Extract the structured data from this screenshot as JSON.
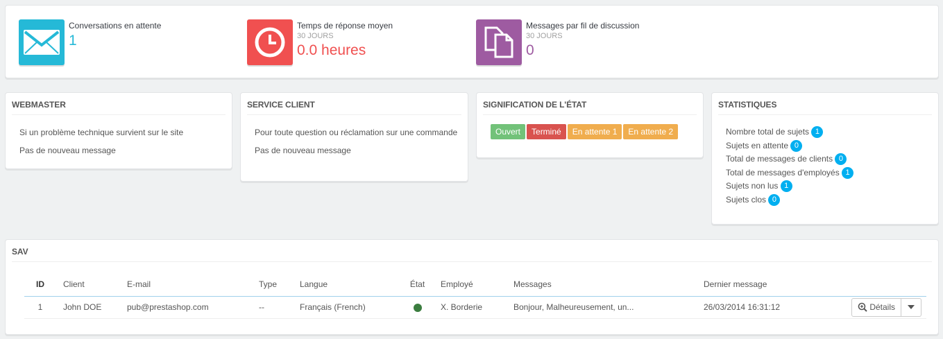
{
  "kpis": [
    {
      "title": "Conversations en attente",
      "sub": "",
      "value": "1",
      "color": "#25b9d7",
      "icon": "envelope-icon"
    },
    {
      "title": "Temps de réponse moyen",
      "sub": "30 JOURS",
      "value": "0.0 heures",
      "color": "#f05050",
      "icon": "clock-icon"
    },
    {
      "title": "Messages par fil de discussion",
      "sub": "30 JOURS",
      "value": "0",
      "color": "#9e5ba1",
      "icon": "copy-icon"
    }
  ],
  "webmaster": {
    "heading": "WEBMASTER",
    "line1": "Si un problème technique survient sur le site",
    "line2": "Pas de nouveau message"
  },
  "service": {
    "heading": "SERVICE CLIENT",
    "line1": "Pour toute question ou réclamation sur une commande",
    "line2": "Pas de nouveau message"
  },
  "states": {
    "heading": "SIGNIFICATION DE L'ÉTAT",
    "items": [
      {
        "label": "Ouvert",
        "color": "#72c279"
      },
      {
        "label": "Terminé",
        "color": "#e08f95"
      },
      {
        "label": "En attente 1",
        "color": "#fbbb22"
      },
      {
        "label": "En attente 2",
        "color": "#fbbb22"
      }
    ]
  },
  "stats": {
    "heading": "STATISTIQUES",
    "items": [
      {
        "label": "Nombre total de sujets",
        "value": "1"
      },
      {
        "label": "Sujets en attente",
        "value": "0"
      },
      {
        "label": "Total de messages de clients",
        "value": "0"
      },
      {
        "label": "Total de messages d'employés",
        "value": "1"
      },
      {
        "label": "Sujets non lus",
        "value": "1"
      },
      {
        "label": "Sujets clos",
        "value": "0"
      }
    ]
  },
  "sav": {
    "heading": "SAV",
    "columns": [
      "ID",
      "Client",
      "E-mail",
      "Type",
      "Langue",
      "État",
      "Employé",
      "Messages",
      "Dernier message"
    ],
    "rows": [
      {
        "id": "1",
        "client": "John DOE",
        "email": "pub@prestashop.com",
        "type": "--",
        "langue": "Français (French)",
        "etat_color": "#3c763d",
        "employe": "X. Borderie",
        "messages": "Bonjour, Malheureusement, un...",
        "dernier": "26/03/2014 16:31:12",
        "action": "Détails"
      }
    ]
  }
}
